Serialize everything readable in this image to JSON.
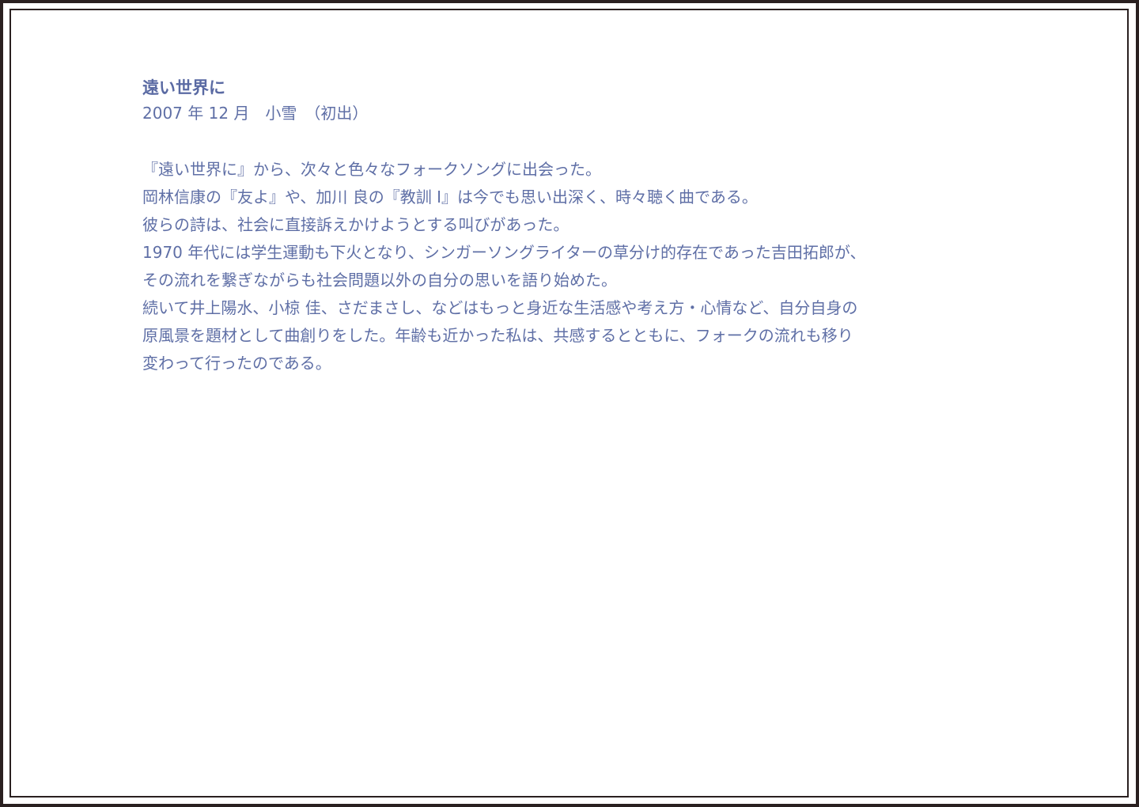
{
  "article": {
    "title": "遠い世界に",
    "meta": "2007 年 12 月　小雪　（初出）",
    "lines": [
      "『遠い世界に』から、次々と色々なフォークソングに出会った。",
      "岡林信康の『友よ』や、加川 良の『教訓 Ⅰ』は今でも思い出深く、時々聴く曲である。",
      "彼らの詩は、社会に直接訴えかけようとする叫びがあった。",
      "1970 年代には学生運動も下火となり、シンガーソングライターの草分け的存在であった吉田拓郎が、",
      "その流れを繋ぎながらも社会問題以外の自分の思いを語り始めた。",
      "続いて井上陽水、小椋 佳、さだまさし、などはもっと身近な生活感や考え方・心情など、自分自身の",
      "原風景を題材として曲創りをした。年齢も近かった私は、共感するとともに、フォークの流れも移り",
      "変わって行ったのである。"
    ]
  },
  "colors": {
    "text": "#5f6fa6",
    "frame": "#2a2020",
    "background": "#ffffff"
  }
}
